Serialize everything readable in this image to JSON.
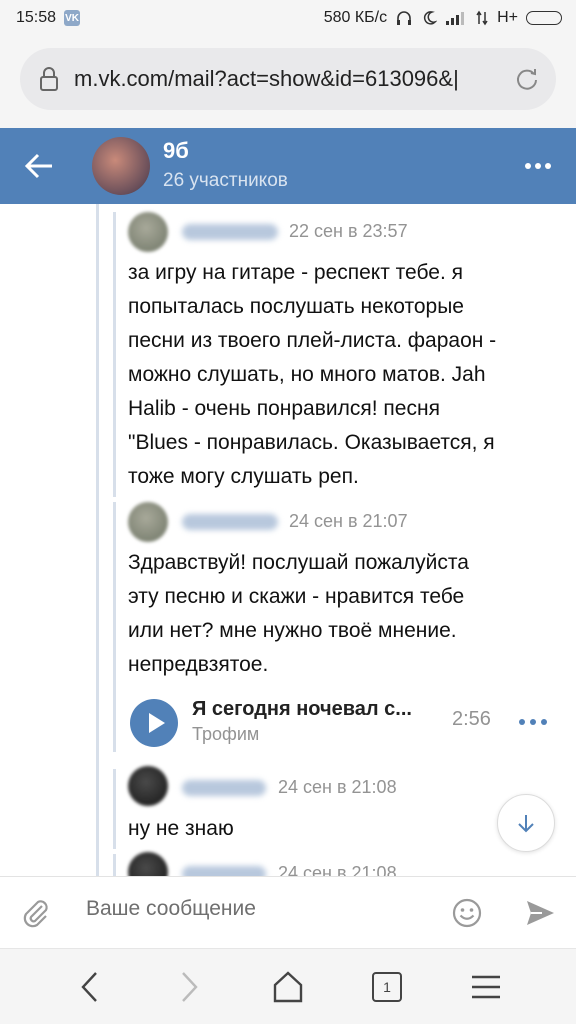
{
  "status_bar": {
    "time": "15:58",
    "speed": "580 КБ/с",
    "network": "H+"
  },
  "browser": {
    "url": "m.vk.com/mail?act=show&id=613096&|"
  },
  "chat_header": {
    "title": "9б",
    "subtitle": "26 участников"
  },
  "messages": [
    {
      "time": "22 сен в 23:57",
      "text_lines": [
        "за игру на гитаре - респект тебе. я",
        "попыталась послушать некоторые",
        "песни из твоего плей-листа. фараон -",
        "можно слушать, но много матов. Jah",
        "Halib - очень понравился! песня",
        "\"Blues - понравилась. Оказывается, я",
        "тоже могу слушать реп."
      ]
    },
    {
      "time": "24 сен в 21:07",
      "text_lines": [
        "Здравствуй! послушай пожалуйста",
        "эту песню и скажи - нравится тебе",
        "или нет? мне нужно твоё мнение.",
        "непредвзятое."
      ],
      "audio": {
        "title": "Я сегодня ночевал с...",
        "artist": "Трофим",
        "duration": "2:56"
      }
    },
    {
      "time": "24 сен в 21:08",
      "text_lines": [
        "ну не знаю"
      ]
    },
    {
      "time": "24 сен в 21:08",
      "text_lines": []
    }
  ],
  "composer": {
    "placeholder": "Ваше сообщение"
  },
  "browser_nav": {
    "tab_count": "1"
  },
  "colors": {
    "vk_blue": "#5181b8",
    "time_gray": "#939393"
  }
}
